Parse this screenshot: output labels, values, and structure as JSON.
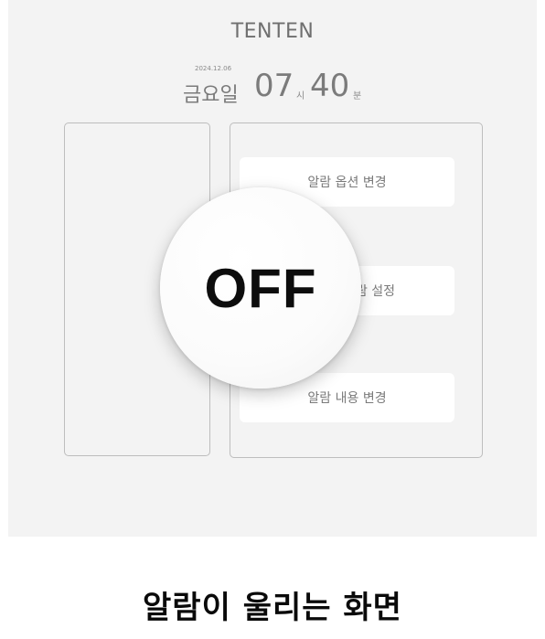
{
  "header": {
    "title": "TENTEN",
    "date": "2024.12.06",
    "weekday": "금요일",
    "hour": "07",
    "hour_unit": "시",
    "minute": "40",
    "minute_unit": "분"
  },
  "menu": {
    "items": [
      {
        "label": "알람 옵션 변경"
      },
      {
        "label": "람 설정"
      },
      {
        "label": "알람 내용 변경"
      }
    ]
  },
  "toggle": {
    "label": "OFF"
  },
  "caption": "알람이 울리는 화면"
}
